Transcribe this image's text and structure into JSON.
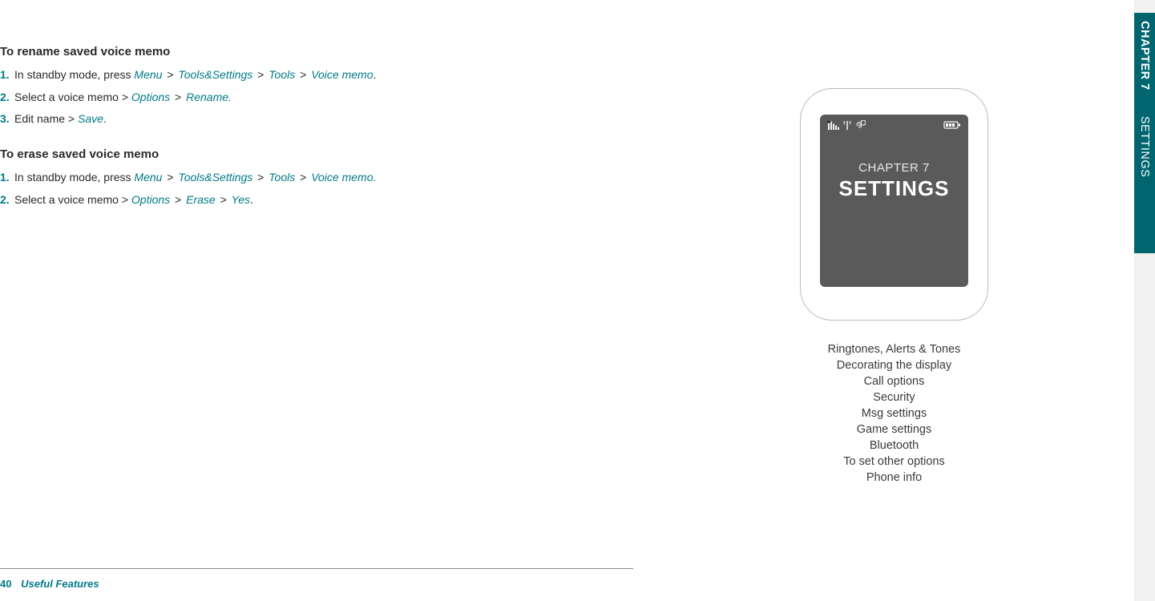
{
  "left": {
    "sections": [
      {
        "heading": "To rename saved voice memo",
        "steps": [
          {
            "parts": [
              {
                "t": "In standby mode, press ",
                "cls": ""
              },
              {
                "t": "Menu",
                "cls": "teal-i"
              },
              {
                "t": " > ",
                "cls": "gt"
              },
              {
                "t": "Tools&Settings",
                "cls": "teal-i"
              },
              {
                "t": " > ",
                "cls": "gt"
              },
              {
                "t": "Tools",
                "cls": "teal-i"
              },
              {
                "t": " > ",
                "cls": "gt"
              },
              {
                "t": "Voice memo",
                "cls": "teal-i"
              },
              {
                "t": ".",
                "cls": ""
              }
            ]
          },
          {
            "parts": [
              {
                "t": "Select a voice memo > ",
                "cls": ""
              },
              {
                "t": "Options",
                "cls": "teal-i"
              },
              {
                "t": " > ",
                "cls": "gt"
              },
              {
                "t": "Rename.",
                "cls": "teal-i"
              }
            ]
          },
          {
            "parts": [
              {
                "t": "Edit name > ",
                "cls": ""
              },
              {
                "t": "Save",
                "cls": "teal-i"
              },
              {
                "t": ".",
                "cls": ""
              }
            ]
          }
        ]
      },
      {
        "heading": "To erase saved voice memo",
        "steps": [
          {
            "parts": [
              {
                "t": "In standby mode, press ",
                "cls": ""
              },
              {
                "t": "Menu",
                "cls": "teal-i"
              },
              {
                "t": " > ",
                "cls": "gt"
              },
              {
                "t": "Tools&Settings",
                "cls": "teal-i"
              },
              {
                "t": " > ",
                "cls": "gt"
              },
              {
                "t": "Tools",
                "cls": "teal-i"
              },
              {
                "t": " > ",
                "cls": "gt"
              },
              {
                "t": "Voice memo.",
                "cls": "teal-i"
              }
            ]
          },
          {
            "parts": [
              {
                "t": "Select a voice memo > ",
                "cls": ""
              },
              {
                "t": "Options",
                "cls": "teal-i"
              },
              {
                "t": " > ",
                "cls": "gt"
              },
              {
                "t": "Erase",
                "cls": "teal-i"
              },
              {
                "t": " > ",
                "cls": "gt"
              },
              {
                "t": "Yes",
                "cls": "teal-i"
              },
              {
                "t": ".",
                "cls": ""
              }
            ]
          }
        ]
      }
    ],
    "footer": {
      "page": "40",
      "chapter": "Useful Features"
    }
  },
  "right": {
    "screen": {
      "chapline": "CHAPTER 7",
      "title": "SETTINGS"
    },
    "toc": [
      "Ringtones, Alerts & Tones",
      "Decorating the display",
      "Call options",
      "Security",
      "Msg settings",
      "Game settings",
      "Bluetooth",
      "To set other options",
      "Phone info"
    ]
  },
  "sidetab": {
    "chap": "CHAPTER 7",
    "title": "SETTINGS"
  },
  "icons": {
    "signal": "signal-icon",
    "link": "link-icon",
    "battery": "battery-icon"
  }
}
